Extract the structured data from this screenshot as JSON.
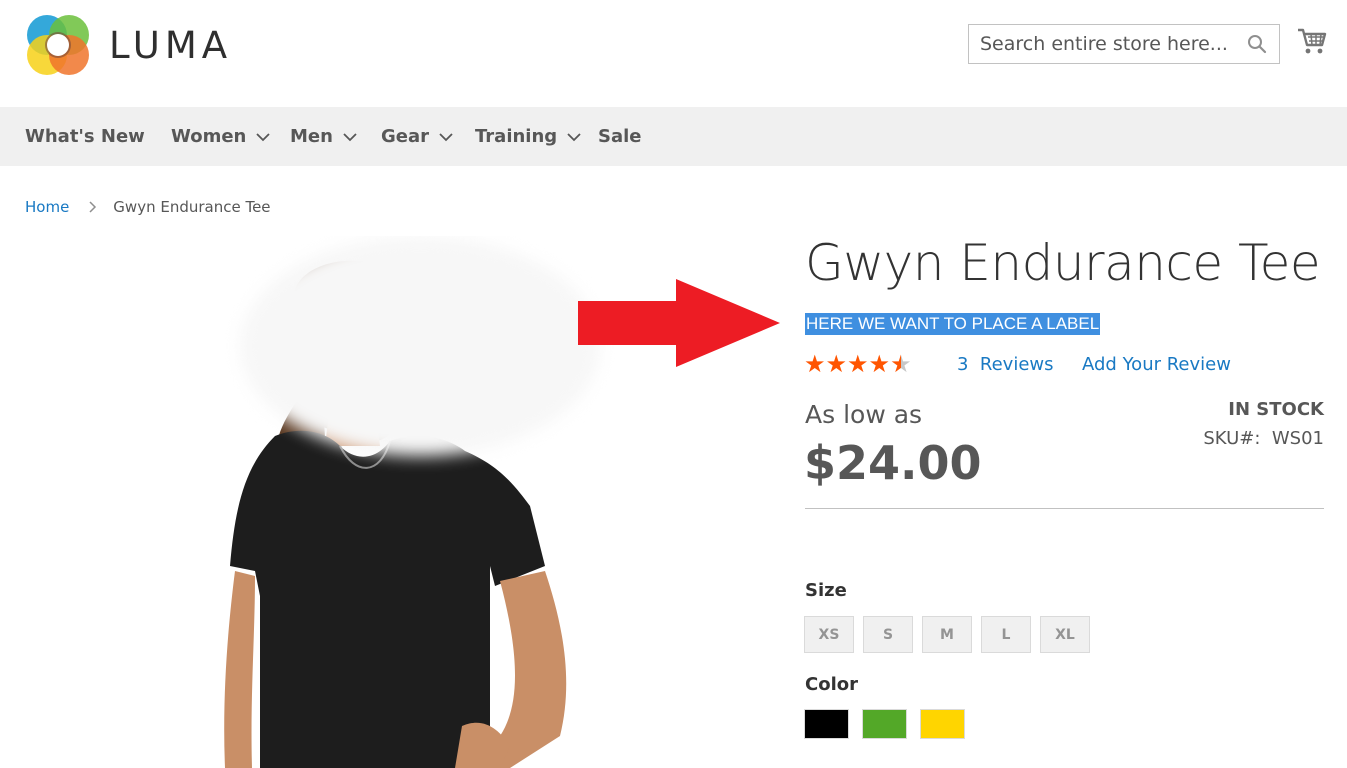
{
  "brand": {
    "name": "LUMA"
  },
  "search": {
    "placeholder": "Search entire store here..."
  },
  "nav": {
    "items": [
      {
        "label": "What's New",
        "has_dropdown": false
      },
      {
        "label": "Women",
        "has_dropdown": true
      },
      {
        "label": "Men",
        "has_dropdown": true
      },
      {
        "label": "Gear",
        "has_dropdown": true
      },
      {
        "label": "Training",
        "has_dropdown": true
      },
      {
        "label": "Sale",
        "has_dropdown": false
      }
    ]
  },
  "breadcrumb": {
    "home": "Home",
    "current": "Gwyn Endurance Tee"
  },
  "product": {
    "title": "Gwyn Endurance Tee",
    "label_text": "HERE WE WANT TO PLACE A LABEL",
    "rating": {
      "stars": 4.5,
      "max": 5,
      "reviews_count": "3",
      "reviews_word": "Reviews",
      "add_review": "Add Your Review"
    },
    "price_prefix": "As low as",
    "price": "$24.00",
    "stock": "IN STOCK",
    "sku_label": "SKU#:",
    "sku_value": "WS01",
    "size_label": "Size",
    "sizes": [
      "XS",
      "S",
      "M",
      "L",
      "XL"
    ],
    "color_label": "Color",
    "colors": [
      "#000000",
      "#53a828",
      "#ffd500"
    ]
  },
  "colors": {
    "accent_link": "#1979c3",
    "star": "#ff5501",
    "arrow": "#ed1c24",
    "selection": "#3f8fe0"
  },
  "icons": [
    "search-icon",
    "cart-icon",
    "chevron-down-icon",
    "breadcrumb-chevron-icon",
    "star-icon",
    "arrow-icon"
  ]
}
